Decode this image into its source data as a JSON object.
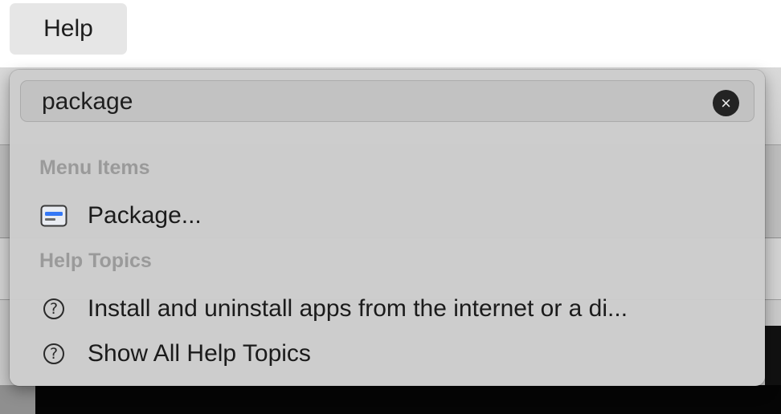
{
  "menubar": {
    "help_menu_label": "Help"
  },
  "search": {
    "value": "package",
    "clear_icon": "clear-search-icon",
    "clear_glyph": "×"
  },
  "sections": {
    "menu_items_header": "Menu Items",
    "help_topics_header": "Help Topics"
  },
  "menu_items": [
    {
      "label": "Package...",
      "icon": "menu-command-icon"
    }
  ],
  "help_topics": [
    {
      "label": "Install and uninstall apps from the internet or a di...",
      "icon": "help-topic-icon"
    },
    {
      "label": "Show All Help Topics",
      "icon": "help-topic-icon"
    }
  ],
  "help_icon_glyph": "?",
  "colors": {
    "accent": "#3478f6",
    "section_header": "#9a9a9a"
  }
}
